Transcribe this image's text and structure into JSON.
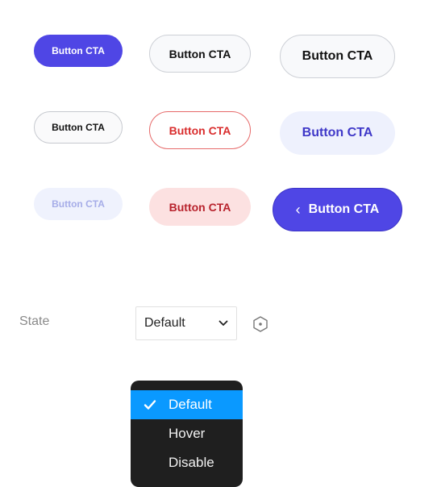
{
  "buttons": {
    "primary_sm": "Button CTA",
    "outline_md": "Button CTA",
    "outline_lg": "Button CTA",
    "outline_sm": "Button CTA",
    "danger_md": "Button CTA",
    "soft_lg": "Button CTA",
    "disabled_sm": "Button CTA",
    "danger_soft_md": "Button CTA",
    "primary_icon_lg": "Button CTA",
    "chevron_glyph": "‹"
  },
  "state": {
    "label": "State",
    "selected": "Default",
    "options": [
      "Default",
      "Hover",
      "Disable"
    ]
  },
  "colors": {
    "primary": "#4F46E5",
    "danger": "#D92D2D",
    "menu_bg": "#1F1F1F",
    "menu_selected": "#0A99FF"
  },
  "icons": {
    "caret": "chevron-down-icon",
    "variant": "hexagon-icon",
    "check": "check-icon"
  }
}
